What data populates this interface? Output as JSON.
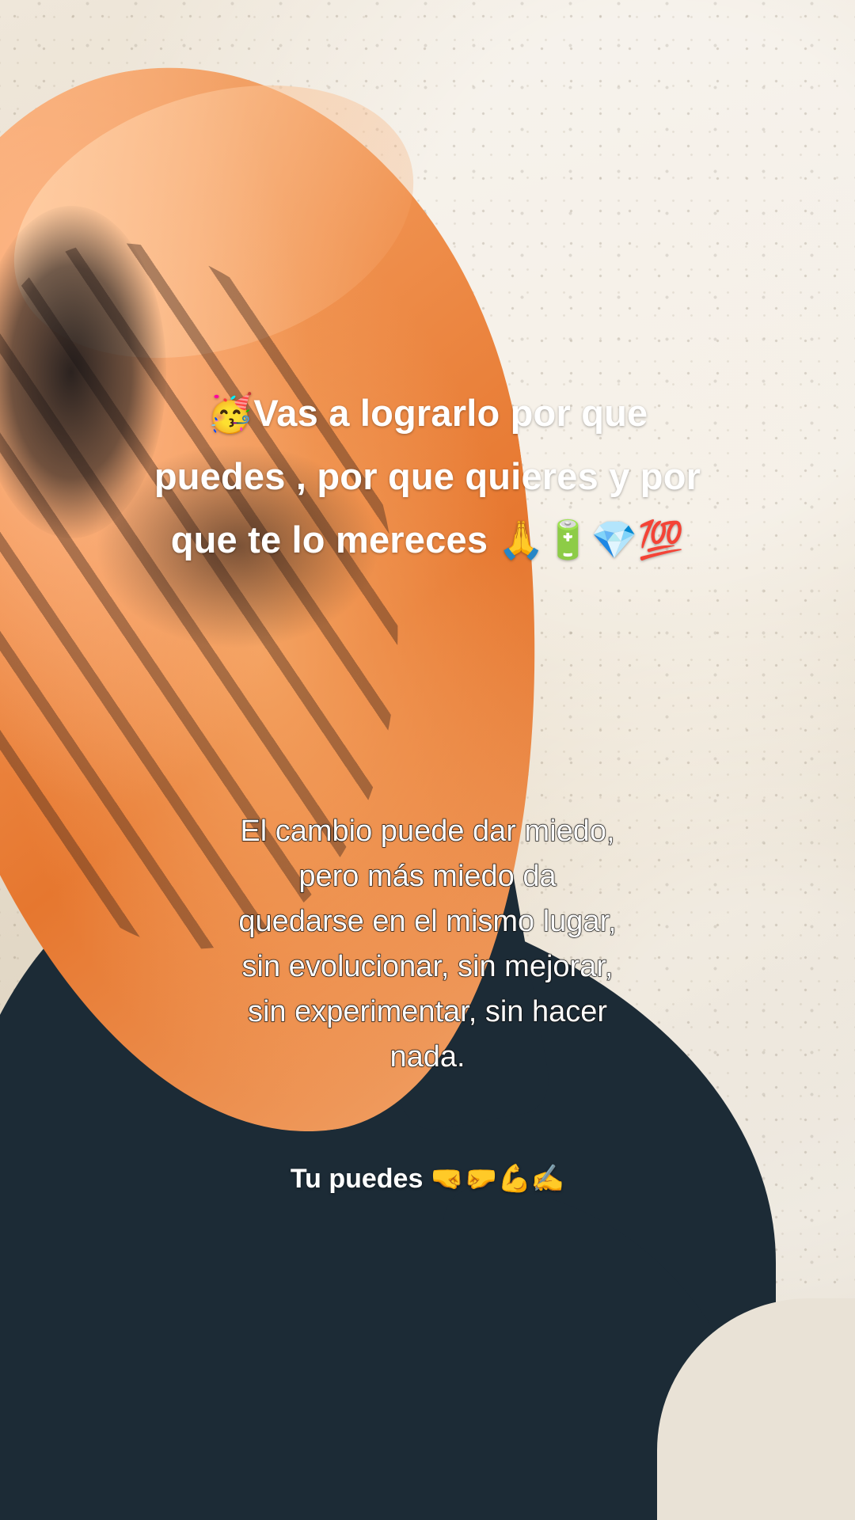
{
  "overlay_text": {
    "top_lines": [
      "🥳Vas a lograrlo por que",
      "puedes , por que quieres y por",
      "que te lo mereces 🙏🔋💎💯"
    ],
    "middle_lines": [
      "El cambio puede dar miedo,",
      "pero más miedo da",
      "quedarse en el mismo lugar,",
      "sin evolucionar, sin mejorar,",
      "sin experimentar, sin hacer",
      "nada."
    ],
    "bottom": "Tu puedes 🤜🤛💪✍️"
  },
  "colors": {
    "scarf_orange": "#ef8f4c",
    "shadow_dark": "#1c2b36",
    "ground_light": "#e6dccb",
    "text": "#ffffff"
  }
}
